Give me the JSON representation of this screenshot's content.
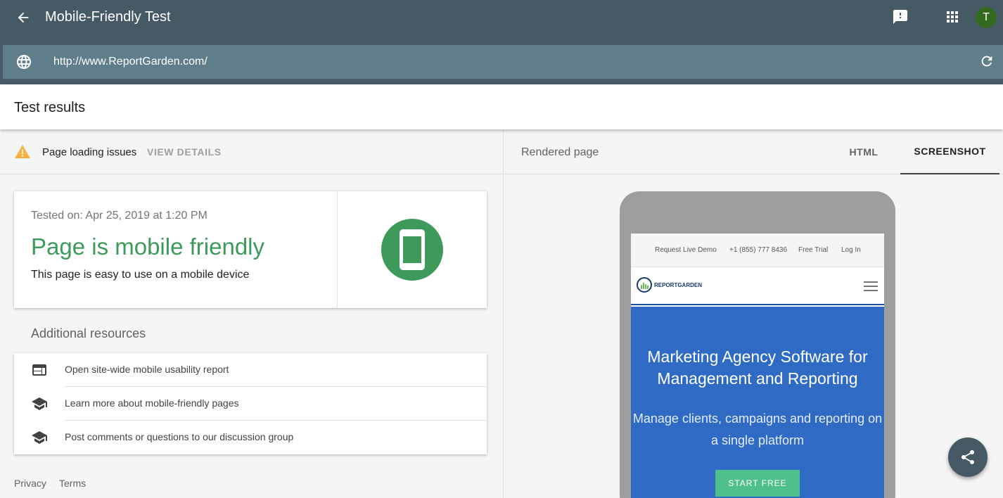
{
  "header": {
    "title": "Mobile-Friendly Test",
    "avatar_initial": "T",
    "url_value": "http://www.ReportGarden.com/"
  },
  "results": {
    "title": "Test results"
  },
  "issues": {
    "label": "Page loading issues",
    "action": "VIEW DETAILS"
  },
  "result_card": {
    "tested_on": "Tested on: Apr 25, 2019 at 1:20 PM",
    "heading": "Page is mobile friendly",
    "description": "This page is easy to use on a mobile device"
  },
  "resources": {
    "title": "Additional resources",
    "items": [
      {
        "label": "Open site-wide mobile usability report",
        "icon": "web-icon"
      },
      {
        "label": "Learn more about mobile-friendly pages",
        "icon": "school-icon"
      },
      {
        "label": "Post comments or questions to our discussion group",
        "icon": "school-icon"
      }
    ]
  },
  "footer": {
    "privacy": "Privacy",
    "terms": "Terms"
  },
  "right_panel": {
    "label": "Rendered page",
    "tabs": [
      {
        "label": "HTML",
        "active": false
      },
      {
        "label": "SCREENSHOT",
        "active": true
      }
    ]
  },
  "preview": {
    "nav_links": [
      "Request Live Demo",
      "+1 (855) 777 8436",
      "Free Trial",
      "Log In"
    ],
    "logo_text": "REPORTGARDEN",
    "hero_title": "Marketing Agency Software for Management and Reporting",
    "hero_subtitle": "Manage clients, campaigns and reporting on a single platform",
    "hero_button": "START FREE"
  },
  "colors": {
    "header_bg": "#455a64",
    "url_bar_bg": "#607d8b",
    "success_green": "#3d9a5b",
    "warning_amber": "#f6b23c",
    "hero_blue": "#2f6bc4",
    "cta_green": "#4fbf8b",
    "avatar_bg": "#33691e"
  }
}
